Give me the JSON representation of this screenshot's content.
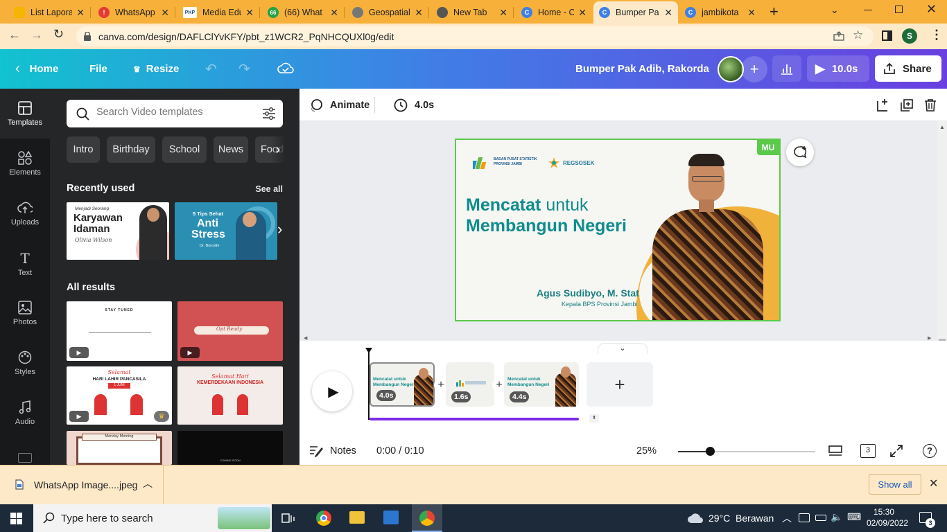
{
  "browser": {
    "tabs": [
      {
        "title": "List Laporan",
        "fav_color": "#f4b400",
        "fav_text": ""
      },
      {
        "title": "WhatsApp",
        "fav_color": "#e53935",
        "fav_text": "!"
      },
      {
        "title": "Media Edu",
        "fav_color": "#ffffff",
        "fav_text": "PKP"
      },
      {
        "title": "(66) What",
        "fav_color": "#25a244",
        "fav_text": "66"
      },
      {
        "title": "Geospatial",
        "fav_color": "#666666",
        "fav_text": ""
      },
      {
        "title": "New Tab",
        "fav_color": "#555555",
        "fav_text": ""
      },
      {
        "title": "Home - Ca",
        "fav_color": "#3f7fe6",
        "fav_text": "C"
      },
      {
        "title": "Bumper Pa",
        "fav_color": "#3f7fe6",
        "fav_text": "C"
      },
      {
        "title": "jambikota",
        "fav_color": "#3f7fe6",
        "fav_text": "C"
      }
    ],
    "url": "canva.com/design/DAFLClYvKFY/pbt_z1WCR2_PqNHCQUXl0g/edit",
    "profile_initial": "S"
  },
  "header": {
    "home": "Home",
    "file": "File",
    "resize": "Resize",
    "design_title": "Bumper Pak Adib, Rakorda",
    "play_duration": "10.0s",
    "share": "Share"
  },
  "rail": [
    {
      "label": "Templates",
      "icon": "templates-icon"
    },
    {
      "label": "Elements",
      "icon": "elements-icon"
    },
    {
      "label": "Uploads",
      "icon": "uploads-icon"
    },
    {
      "label": "Text",
      "icon": "text-icon"
    },
    {
      "label": "Photos",
      "icon": "photos-icon"
    },
    {
      "label": "Styles",
      "icon": "styles-icon"
    },
    {
      "label": "Audio",
      "icon": "audio-icon"
    }
  ],
  "panel": {
    "search_placeholder": "Search Video templates",
    "chips": [
      "Intro",
      "Birthday",
      "School",
      "News",
      "Food"
    ],
    "recently_used": "Recently used",
    "see_all": "See all",
    "all_results": "All results",
    "recent_thumbs": [
      {
        "line1": "Menjadi Seorang",
        "line2": "Karyawan",
        "line3": "Idaman",
        "sign": "Olivia Wilson"
      },
      {
        "line1": "5 Tips Sehat",
        "line2": "Anti",
        "line3": "Stress",
        "sign": "Dr. Borcelle"
      }
    ],
    "results": [
      {
        "text": "STAY TUNED"
      },
      {
        "text": "Opt Ready"
      },
      {
        "text1": "Selamat",
        "text2": "HARI LAHIR PANCASILA",
        "text3": "1 JUNI"
      },
      {
        "text1": "Selamat Hari",
        "text2": "KEMERDEKAAN INDONESIA"
      },
      {
        "text": "Monday Morning"
      },
      {
        "text": "COMING SOON"
      }
    ]
  },
  "editor": {
    "animate": "Animate",
    "duration": "4.0s",
    "slide": {
      "logo1_line1": "BADAN PUSAT STATISTIK",
      "logo1_line2": "PROVINSI JAMBI",
      "logo2": "REGSOSEK",
      "title_bold1": "Mencatat",
      "title_light": " untuk",
      "title2": "Membangun Negeri",
      "name": "Agus Sudibyo, M. Stat",
      "job": "Kepala BPS Provinsi Jambi",
      "tag": "MU"
    }
  },
  "timeline": {
    "pages": [
      {
        "duration": "4.0s",
        "title1": "Mencatat untuk",
        "title2": "Membangun Negeri",
        "name": "Agus Sudibyo, M. Stat"
      },
      {
        "duration": "1.6s"
      },
      {
        "duration": "4.4s",
        "title1": "Mencatat untuk",
        "title2": "Membangun Negeri",
        "name": "Agus Sudibyo, M. Stat"
      }
    ]
  },
  "bottom": {
    "notes": "Notes",
    "time": "0:00 / 0:10",
    "zoom": "25%",
    "zoom_fraction": 0.23,
    "page_count": "3"
  },
  "download": {
    "file": "WhatsApp Image....jpeg",
    "show_all": "Show all"
  },
  "taskbar": {
    "search": "Type here to search",
    "weather": "29°C  Berawan",
    "time": "15:30",
    "date": "02/09/2022",
    "notif_count": "3"
  },
  "colors": {
    "accent_teal": "#12c2cf",
    "accent_purple": "#6a3fe0",
    "slide_green_border": "#5bc94a",
    "slide_title": "#0f8c8c",
    "timeline_progress": "#7d2ae8"
  }
}
